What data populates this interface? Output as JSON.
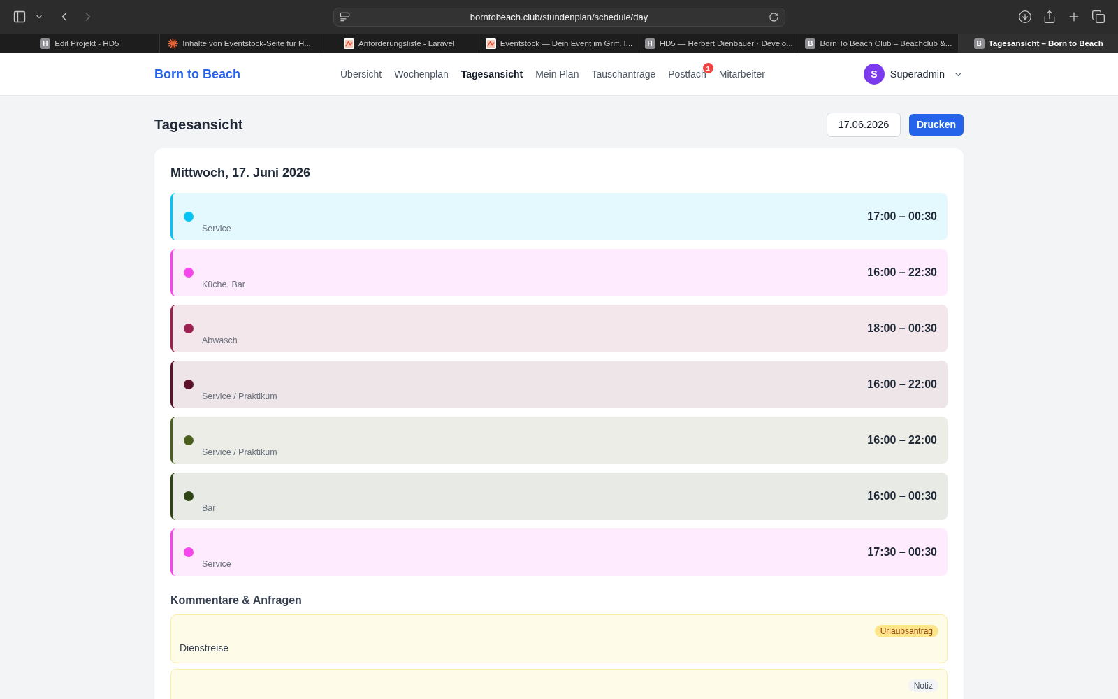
{
  "browser": {
    "url": "borntobeach.club/stundenplan/schedule/day",
    "tabs": [
      {
        "title": "Edit Projekt - HD5",
        "kind": "letter",
        "favicon_letter": "H",
        "selected": false
      },
      {
        "title": "Inhalte von Eventstock-Seite für H...",
        "kind": "sparkle",
        "selected": false
      },
      {
        "title": "Anforderungsliste - Laravel",
        "kind": "image",
        "selected": false
      },
      {
        "title": "Eventstock — Dein Event im Griff. I...",
        "kind": "image",
        "selected": false
      },
      {
        "title": "HD5 — Herbert Dienbauer · Develo...",
        "kind": "letter",
        "favicon_letter": "H",
        "selected": false
      },
      {
        "title": "Born To Beach Club – Beachclub &...",
        "kind": "letter",
        "favicon_letter": "B",
        "selected": false
      },
      {
        "title": "Tagesansicht – Born to Beach",
        "kind": "letter",
        "favicon_letter": "B",
        "selected": true
      }
    ]
  },
  "nav": {
    "logo": "Born to Beach",
    "items": [
      {
        "label": "Übersicht",
        "selected": false
      },
      {
        "label": "Wochenplan",
        "selected": false
      },
      {
        "label": "Tagesansicht",
        "selected": true
      },
      {
        "label": "Mein Plan",
        "selected": false
      },
      {
        "label": "Tauschanträge",
        "selected": false
      },
      {
        "label": "Postfach",
        "selected": false,
        "badge": "1"
      },
      {
        "label": "Mitarbeiter",
        "selected": false
      }
    ],
    "user": {
      "initial": "S",
      "name": "Superadmin"
    }
  },
  "page": {
    "title": "Tagesansicht",
    "date": "17.06.2026",
    "print_button": "Drucken"
  },
  "day": {
    "heading": "Mittwoch, 17. Juni 2026",
    "shifts": [
      {
        "color": "#06c4f5",
        "role": "Service",
        "time": "17:00 – 00:30"
      },
      {
        "color": "#f745ee",
        "role": "Küche, Bar",
        "time": "16:00 – 22:30"
      },
      {
        "color": "#9c2150",
        "role": "Abwasch",
        "time": "18:00 – 00:30"
      },
      {
        "color": "#5c1228",
        "role": "Service / Praktikum",
        "time": "16:00 – 22:00"
      },
      {
        "color": "#4b5f1c",
        "role": "Service / Praktikum",
        "time": "16:00 – 22:00"
      },
      {
        "color": "#2f4614",
        "role": "Bar",
        "time": "16:00 – 00:30"
      },
      {
        "color": "#f745ee",
        "role": "Service",
        "time": "17:30 – 00:30"
      }
    ]
  },
  "comments": {
    "heading": "Kommentare & Anfragen",
    "items": [
      {
        "kind": "request",
        "badge": "Urlaubsantrag",
        "text": "Dienstreise"
      },
      {
        "kind": "note",
        "badge": "Notiz"
      }
    ]
  }
}
